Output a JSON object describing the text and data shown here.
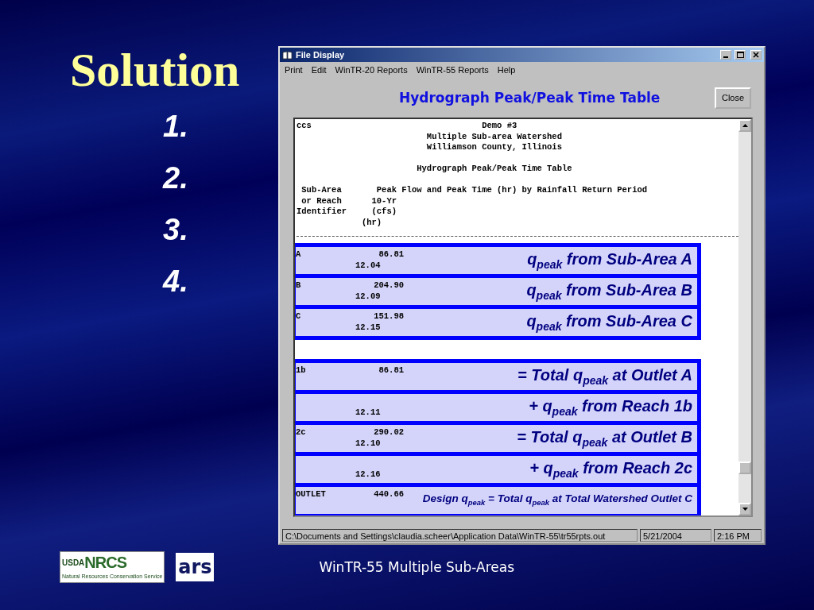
{
  "slide": {
    "title": "Solution",
    "steps": [
      "1.",
      "2.",
      "3.",
      "4."
    ],
    "footer": "WinTR-55 Multiple Sub-Areas",
    "logos": {
      "usda": "USDA",
      "nrcs": "NRCS",
      "tagline": "Natural Resources Conservation Service",
      "ars": "ars"
    }
  },
  "window": {
    "title": "File Display",
    "menu": [
      "Print",
      "Edit",
      "WinTR-20 Reports",
      "WinTR-55 Reports",
      "Help"
    ],
    "heading": "Hydrograph Peak/Peak Time Table",
    "close_button": "Close",
    "report_blocks": [
      [
        "ccs                                  Demo #3",
        "                          Multiple Sub-area Watershed",
        "                          Williamson County, Illinois"
      ],
      [
        "                        Hydrograph Peak/Peak Time Table"
      ],
      [
        " Sub-Area       Peak Flow and Peak Time (hr) by Rainfall Return Period",
        " or Reach      10-Yr",
        "Identifier     (cfs)",
        "             (hr)"
      ]
    ],
    "callout_groups": [
      {
        "rows": [
          {
            "id": "A",
            "flow": "86.81",
            "time": "12.04",
            "note": "q$_{peak}$ from Sub-Area A"
          },
          {
            "id": "B",
            "flow": "204.90",
            "time": "12.09",
            "note": "q$_{peak}$ from Sub-Area B"
          },
          {
            "id": "C",
            "flow": "151.98",
            "time": "12.15",
            "note": "q$_{peak}$ from Sub-Area C"
          }
        ]
      },
      {
        "rows": [
          {
            "id": "1b",
            "flow": "86.81",
            "note": "= Total q$_{peak}$ at Outlet A"
          },
          {
            "time": "12.11",
            "note": "+ q$_{peak}$ from Reach 1b"
          },
          {
            "id": "2c",
            "flow": "290.02",
            "time": "12.10",
            "note": "= Total q$_{peak}$ at Outlet B"
          },
          {
            "time": "12.16",
            "note": "+ q$_{peak}$ from Reach 2c"
          },
          {
            "id": "OUTLET",
            "flow": "440.66",
            "note": "Design q$_{peak}$ = Total q$_{peak}$ at Total Watershed Outlet C"
          }
        ]
      }
    ],
    "status_bar": [
      "C:\\Documents and Settings\\claudia.scheer\\Application Data\\WinTR-55\\tr55rpts.out",
      "5/21/2004",
      "2:16 PM"
    ]
  }
}
